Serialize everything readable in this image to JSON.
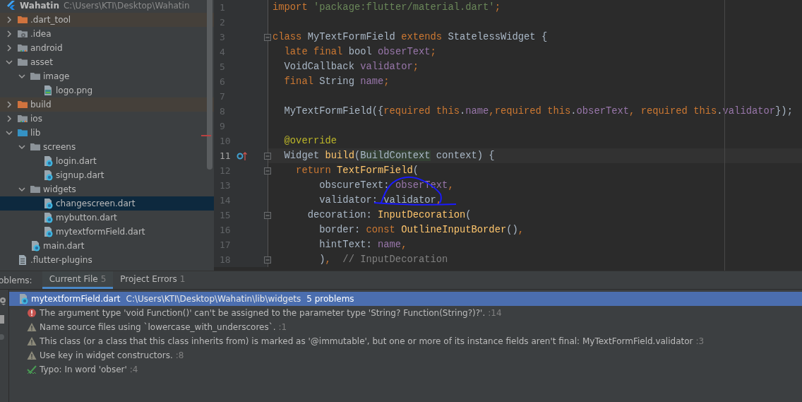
{
  "project": {
    "name": "Wahatin",
    "path": "C:\\Users\\KTI\\Desktop\\Wahatin"
  },
  "tree": [
    {
      "name": ".dart_tool",
      "kind": "excluded-folder",
      "expanded": false,
      "selected": false
    },
    {
      "name": ".idea",
      "kind": "config-folder",
      "expanded": false,
      "selected": false
    },
    {
      "name": "android",
      "kind": "module-folder",
      "expanded": false,
      "selected": false
    },
    {
      "name": "asset",
      "kind": "folder",
      "expanded": true,
      "selected": false,
      "children": [
        {
          "name": "image",
          "kind": "folder",
          "expanded": true,
          "selected": false,
          "children": [
            {
              "name": "logo.png",
              "kind": "image-file",
              "selected": false
            }
          ]
        }
      ]
    },
    {
      "name": "build",
      "kind": "excluded-folder",
      "expanded": false,
      "selected": false
    },
    {
      "name": "ios",
      "kind": "module-folder",
      "expanded": false,
      "selected": false
    },
    {
      "name": "lib",
      "kind": "source-folder",
      "expanded": true,
      "selected": false,
      "children": [
        {
          "name": "screens",
          "kind": "folder",
          "expanded": true,
          "selected": false,
          "children": [
            {
              "name": "login.dart",
              "kind": "dart-file",
              "selected": false
            },
            {
              "name": "signup.dart",
              "kind": "dart-file",
              "selected": false
            }
          ]
        },
        {
          "name": "widgets",
          "kind": "folder",
          "expanded": true,
          "selected": false,
          "children": [
            {
              "name": "changescreen.dart",
              "kind": "dart-file",
              "selected": true
            },
            {
              "name": "mybutton.dart",
              "kind": "dart-file",
              "selected": false
            },
            {
              "name": "mytextformField.dart",
              "kind": "dart-file",
              "selected": false
            }
          ]
        },
        {
          "name": "main.dart",
          "kind": "dart-file",
          "selected": false
        }
      ]
    },
    {
      "name": ".flutter-plugins",
      "kind": "text-file",
      "selected": false
    }
  ],
  "editor": {
    "lines": [
      {
        "number": "1",
        "current": false,
        "fold": false,
        "tokens": [
          {
            "text": "import ",
            "kind": "keyword"
          },
          {
            "text": "'package:flutter/material.dart'",
            "kind": "string"
          },
          {
            "text": ";",
            "kind": "keyword"
          }
        ]
      },
      {
        "number": "2",
        "current": false,
        "fold": false
      },
      {
        "number": "3",
        "current": false,
        "fold": true,
        "tokens": [
          {
            "text": "class ",
            "kind": "keyword"
          },
          {
            "text": "MyTextFormField ",
            "kind": "plain"
          },
          {
            "text": "extends ",
            "kind": "keyword"
          },
          {
            "text": "StatelessWidget {",
            "kind": "plain"
          }
        ]
      },
      {
        "number": "4",
        "current": false,
        "fold": false,
        "tokens": [
          {
            "text": "  late final ",
            "kind": "keyword"
          },
          {
            "text": "bool ",
            "kind": "plain"
          },
          {
            "text": "obserText",
            "kind": "field"
          },
          {
            "text": ";",
            "kind": "keyword"
          }
        ]
      },
      {
        "number": "5",
        "current": false,
        "fold": false,
        "tokens": [
          {
            "text": "  VoidCallback ",
            "kind": "plain"
          },
          {
            "text": "validator",
            "kind": "field"
          },
          {
            "text": ";",
            "kind": "keyword"
          }
        ]
      },
      {
        "number": "6",
        "current": false,
        "fold": false,
        "tokens": [
          {
            "text": "  final ",
            "kind": "keyword"
          },
          {
            "text": "String ",
            "kind": "plain"
          },
          {
            "text": "name",
            "kind": "field"
          },
          {
            "text": ";",
            "kind": "keyword"
          }
        ]
      },
      {
        "number": "7",
        "current": false,
        "fold": false
      },
      {
        "number": "8",
        "current": false,
        "fold": false,
        "tokens": [
          {
            "text": "  MyTextFormField({",
            "kind": "plain"
          },
          {
            "text": "required this",
            "kind": "keyword"
          },
          {
            "text": ".",
            "kind": "plain"
          },
          {
            "text": "name",
            "kind": "field"
          },
          {
            "text": ",",
            "kind": "keyword"
          },
          {
            "text": "required this",
            "kind": "keyword"
          },
          {
            "text": ".",
            "kind": "plain"
          },
          {
            "text": "obserText",
            "kind": "field"
          },
          {
            "text": ", ",
            "kind": "keyword"
          },
          {
            "text": "required this",
            "kind": "keyword"
          },
          {
            "text": ".",
            "kind": "plain"
          },
          {
            "text": "validator",
            "kind": "field"
          },
          {
            "text": "});",
            "kind": "plain"
          }
        ]
      },
      {
        "number": "9",
        "current": false,
        "fold": false
      },
      {
        "number": "10",
        "current": false,
        "fold": false,
        "tokens": [
          {
            "text": "  @override",
            "kind": "annotation"
          }
        ]
      },
      {
        "number": "11",
        "current": true,
        "fold": true,
        "override": true,
        "tokens": [
          {
            "text": "  Widget ",
            "kind": "plain"
          },
          {
            "text": "build",
            "kind": "function"
          },
          {
            "text": "(",
            "kind": "plain"
          },
          {
            "text": "BuildContext",
            "kind": "highlight"
          },
          {
            "text": " context) {",
            "kind": "plain"
          }
        ]
      },
      {
        "number": "12",
        "current": false,
        "fold": true,
        "tokens": [
          {
            "text": "    return ",
            "kind": "keyword"
          },
          {
            "text": "TextFormField",
            "kind": "function"
          },
          {
            "text": "(",
            "kind": "plain"
          }
        ]
      },
      {
        "number": "13",
        "current": false,
        "fold": false,
        "tokens": [
          {
            "text": "        obscureText: ",
            "kind": "plain"
          },
          {
            "text": "obserText",
            "kind": "field"
          },
          {
            "text": ",",
            "kind": "keyword"
          }
        ]
      },
      {
        "number": "14",
        "current": false,
        "fold": false,
        "tokens": [
          {
            "text": "        validator: validator",
            "kind": "plain"
          },
          {
            "text": ",",
            "kind": "keyword"
          }
        ]
      },
      {
        "number": "15",
        "current": false,
        "fold": true,
        "tokens": [
          {
            "text": "      decoration: ",
            "kind": "plain"
          },
          {
            "text": "InputDecoration",
            "kind": "function"
          },
          {
            "text": "(",
            "kind": "plain"
          }
        ]
      },
      {
        "number": "16",
        "current": false,
        "fold": false,
        "tokens": [
          {
            "text": "        border: ",
            "kind": "plain"
          },
          {
            "text": "const ",
            "kind": "keyword"
          },
          {
            "text": "OutlineInputBorder",
            "kind": "function"
          },
          {
            "text": "()",
            "kind": "plain"
          },
          {
            "text": ",",
            "kind": "keyword"
          }
        ]
      },
      {
        "number": "17",
        "current": false,
        "fold": false,
        "tokens": [
          {
            "text": "        hintText: ",
            "kind": "plain"
          },
          {
            "text": "name",
            "kind": "field"
          },
          {
            "text": ",",
            "kind": "keyword"
          }
        ]
      },
      {
        "number": "18",
        "current": false,
        "fold": true,
        "tokens": [
          {
            "text": "        )",
            "kind": "plain"
          },
          {
            "text": ",",
            "kind": "keyword"
          },
          {
            "text": "  // InputDecoration",
            "kind": "comment"
          }
        ]
      }
    ]
  },
  "problems": {
    "title": "oblems:",
    "tabs": [
      {
        "label": "Current File",
        "count": "5",
        "selected": true
      },
      {
        "label": "Project Errors",
        "count": "1",
        "selected": false
      }
    ],
    "file": {
      "name": "mytextformField.dart",
      "path": "C:\\Users\\KTI\\Desktop\\Wahatin\\lib\\widgets",
      "summary": "5 problems"
    },
    "items": [
      {
        "kind": "error",
        "message": "The argument type 'void Function()' can't be assigned to the parameter type 'String? Function(String?)?'.",
        "location": ":14"
      },
      {
        "kind": "warning",
        "message": "Name source files using `lowercase_with_underscores`.",
        "location": ":1"
      },
      {
        "kind": "warning",
        "message": "This class (or a class that this class inherits from) is marked as '@immutable', but one or more of its instance fields aren't final: MyTextFormField.validator",
        "location": ":3"
      },
      {
        "kind": "warning",
        "message": "Use key in widget constructors.",
        "location": ":8"
      },
      {
        "kind": "typo",
        "message": "Typo: In word 'obser'",
        "location": ":4"
      }
    ]
  }
}
